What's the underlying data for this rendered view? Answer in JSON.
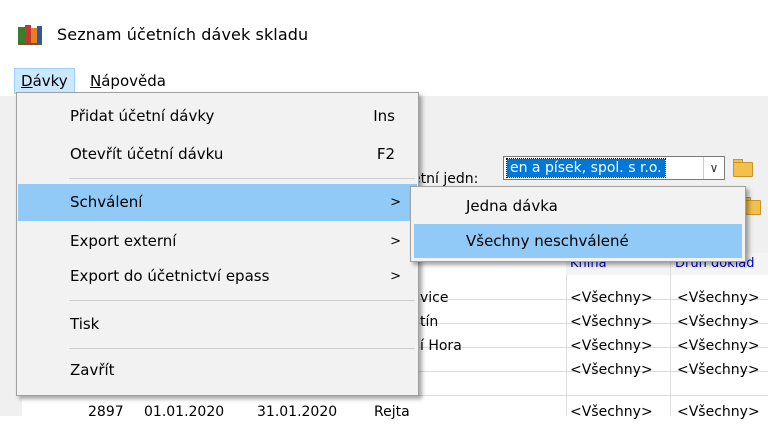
{
  "window": {
    "title": "Seznam účetních dávek skladu"
  },
  "menubar": {
    "items": [
      {
        "label": "Dávky",
        "underline": "D",
        "rest": "ávky"
      },
      {
        "label": "Nápověda",
        "underline": "N",
        "rest": "ápověda"
      }
    ]
  },
  "dropdown": {
    "items": [
      {
        "label": "Přidat účetní dávky",
        "shortcut": "Ins"
      },
      {
        "label": "Otevřít účetní dávku",
        "shortcut": "F2"
      },
      {
        "label": "Schválení",
        "arrow": ">"
      },
      {
        "label": "Export externí",
        "arrow": ">"
      },
      {
        "label": "Export do účetnictví  epass",
        "arrow": ">"
      },
      {
        "label": "Tisk"
      },
      {
        "label": "Zavřít"
      }
    ]
  },
  "submenu": {
    "items": [
      {
        "label": "Jedna dávka"
      },
      {
        "label": "Všechny neschválené"
      }
    ]
  },
  "background": {
    "label_fragment": "etní jedn:",
    "combo_value": "en a písek, spol. s r.o.",
    "combo_arrow": "∨",
    "headers": {
      "kniha": "Kniha",
      "druh": "Druh doklad"
    },
    "rows": [
      {
        "name": "vice",
        "kniha": "<Všechny>",
        "druh": "<Všechny>"
      },
      {
        "name": "tín",
        "kniha": "<Všechny>",
        "druh": "<Všechny>"
      },
      {
        "name": "í Hora",
        "kniha": "<Všechny>",
        "druh": "<Všechny>"
      },
      {
        "name": "",
        "kniha": "<Všechny>",
        "druh": "<Všechny>"
      },
      {
        "id": "2897",
        "from": "01.01.2020",
        "to": "31.01.2020",
        "name": "Rejta",
        "kniha": "<Všechny>",
        "druh": "<Všechny>"
      }
    ]
  },
  "colors": {
    "highlight": "#91c9f7",
    "selection": "#0078d7",
    "menu_bg": "#f2f2f2"
  }
}
